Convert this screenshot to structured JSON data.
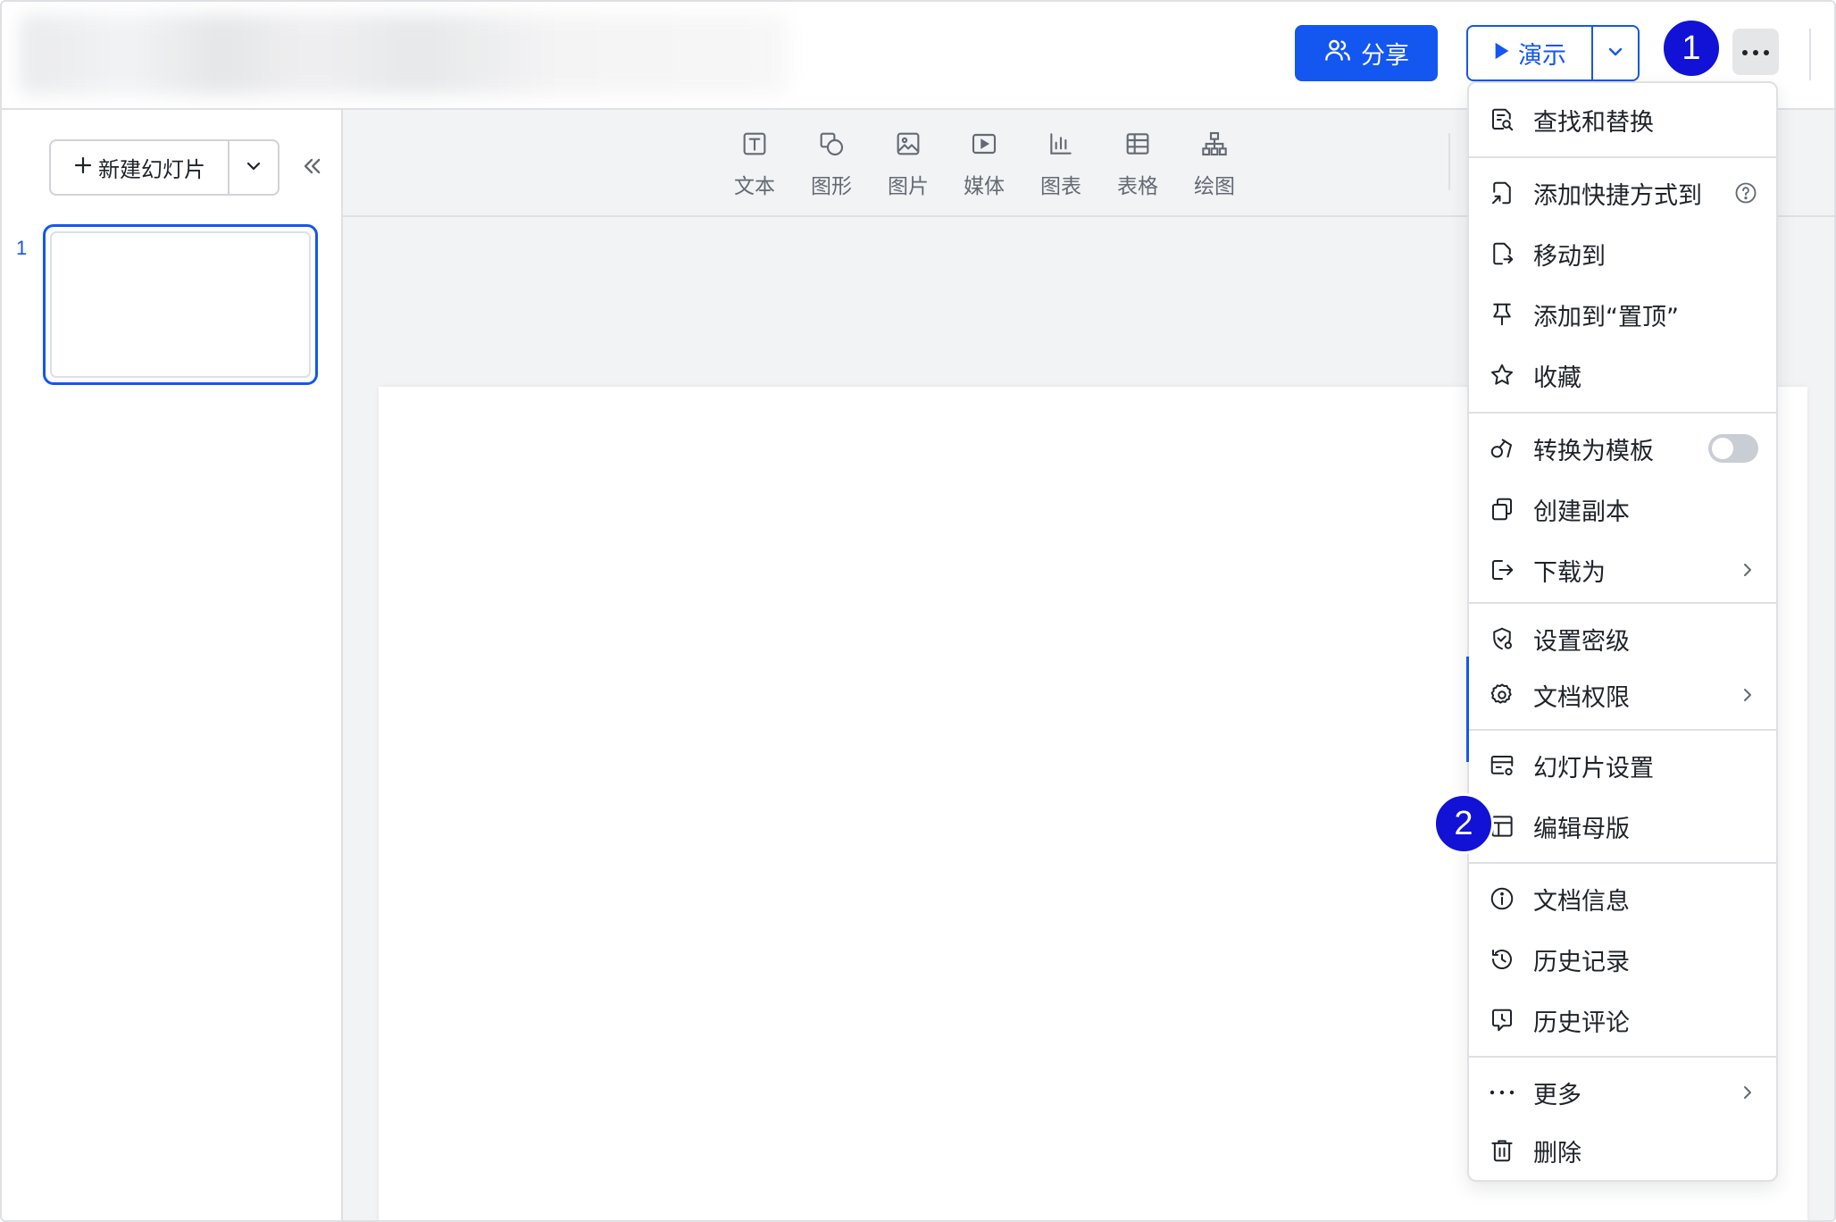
{
  "header": {
    "share_label": "分享",
    "present_label": "演示"
  },
  "badges": {
    "first": "1",
    "second": "2"
  },
  "sidebar": {
    "new_slide_label": "新建幻灯片",
    "slide_number": "1"
  },
  "toolbar": {
    "items": [
      {
        "label": "文本",
        "icon": "text-icon"
      },
      {
        "label": "图形",
        "icon": "shape-icon"
      },
      {
        "label": "图片",
        "icon": "image-icon"
      },
      {
        "label": "媒体",
        "icon": "media-icon"
      },
      {
        "label": "图表",
        "icon": "chart-icon"
      },
      {
        "label": "表格",
        "icon": "table-icon"
      },
      {
        "label": "绘图",
        "icon": "diagram-icon"
      }
    ]
  },
  "menu": {
    "items": [
      {
        "label": "查找和替换",
        "icon": "find-replace-icon"
      },
      {
        "label": "添加快捷方式到",
        "icon": "shortcut-icon",
        "right": "help-icon"
      },
      {
        "label": "移动到",
        "icon": "move-icon"
      },
      {
        "label": "添加到“置顶”",
        "icon": "pin-icon"
      },
      {
        "label": "收藏",
        "icon": "star-icon"
      },
      {
        "label": "转换为模板",
        "icon": "template-icon",
        "right": "toggle",
        "toggle_on": false
      },
      {
        "label": "创建副本",
        "icon": "copy-icon"
      },
      {
        "label": "下载为",
        "icon": "download-icon",
        "right": "chevron-right-icon"
      },
      {
        "label": "设置密级",
        "icon": "security-level-icon"
      },
      {
        "label": "文档权限",
        "icon": "permission-gear-icon",
        "right": "chevron-right-icon"
      },
      {
        "label": "幻灯片设置",
        "icon": "slide-settings-icon"
      },
      {
        "label": "编辑母版",
        "icon": "master-icon"
      },
      {
        "label": "文档信息",
        "icon": "info-icon"
      },
      {
        "label": "历史记录",
        "icon": "history-icon"
      },
      {
        "label": "历史评论",
        "icon": "comment-history-icon"
      },
      {
        "label": "更多",
        "icon": "more-dots-icon",
        "right": "chevron-right-icon"
      },
      {
        "label": "删除",
        "icon": "trash-icon"
      }
    ]
  },
  "colors": {
    "brand_blue": "#1456f0",
    "badge_blue": "#1112d6",
    "toolbar_bg": "#f2f3f5"
  }
}
